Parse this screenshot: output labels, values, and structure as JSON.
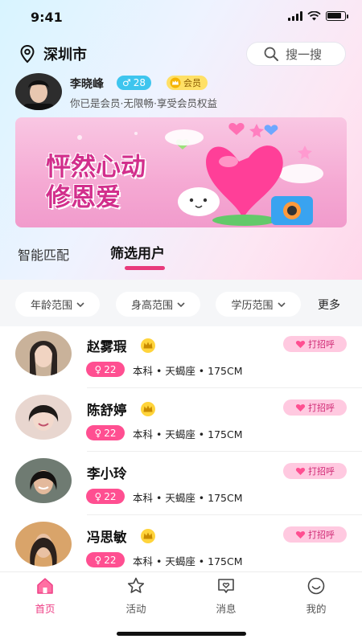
{
  "status_bar": {
    "time": "9:41",
    "battery_level": 0.85
  },
  "header": {
    "location": "深圳市",
    "search_placeholder": "搜一搜"
  },
  "current_user": {
    "name": "李晓峰",
    "gender_symbol": "♂",
    "age": "28",
    "vip_label": "会员",
    "description": "你已是会员·无限畅·享受会员权益"
  },
  "banner": {
    "line1": "怦然心动",
    "line2": "修恩爱"
  },
  "tabs": [
    {
      "label": "智能匹配",
      "active": false
    },
    {
      "label": "筛选用户",
      "active": true
    }
  ],
  "filters": {
    "chips": [
      {
        "label": "年龄范围"
      },
      {
        "label": "身高范围"
      },
      {
        "label": "学历范围"
      }
    ],
    "more_label": "更多"
  },
  "users": [
    {
      "name": "赵雾瑕",
      "vip": true,
      "age": "22",
      "info": "本科 • 天蝎座 • 175CM",
      "action": "打招呼"
    },
    {
      "name": "陈舒婷",
      "vip": true,
      "age": "22",
      "info": "本科 • 天蝎座 • 175CM",
      "action": "打招呼"
    },
    {
      "name": "李小玲",
      "vip": false,
      "age": "22",
      "info": "本科 • 天蝎座 • 175CM",
      "action": "打招呼"
    },
    {
      "name": "冯思敏",
      "vip": true,
      "age": "22",
      "info": "本科 • 天蝎座 • 175CM",
      "action": "打招呼"
    }
  ],
  "female_symbol": "♀",
  "tabbar": [
    {
      "label": "首页",
      "icon": "home-icon",
      "active": true
    },
    {
      "label": "活动",
      "icon": "star-icon",
      "active": false
    },
    {
      "label": "消息",
      "icon": "message-heart-icon",
      "active": false
    },
    {
      "label": "我的",
      "icon": "smile-profile-icon",
      "active": false
    }
  ],
  "colors": {
    "accent": "#ee3f86",
    "age_badge": "#ff4f91",
    "male_badge": "#3ec5ee",
    "vip_gold": "#ffe066"
  }
}
